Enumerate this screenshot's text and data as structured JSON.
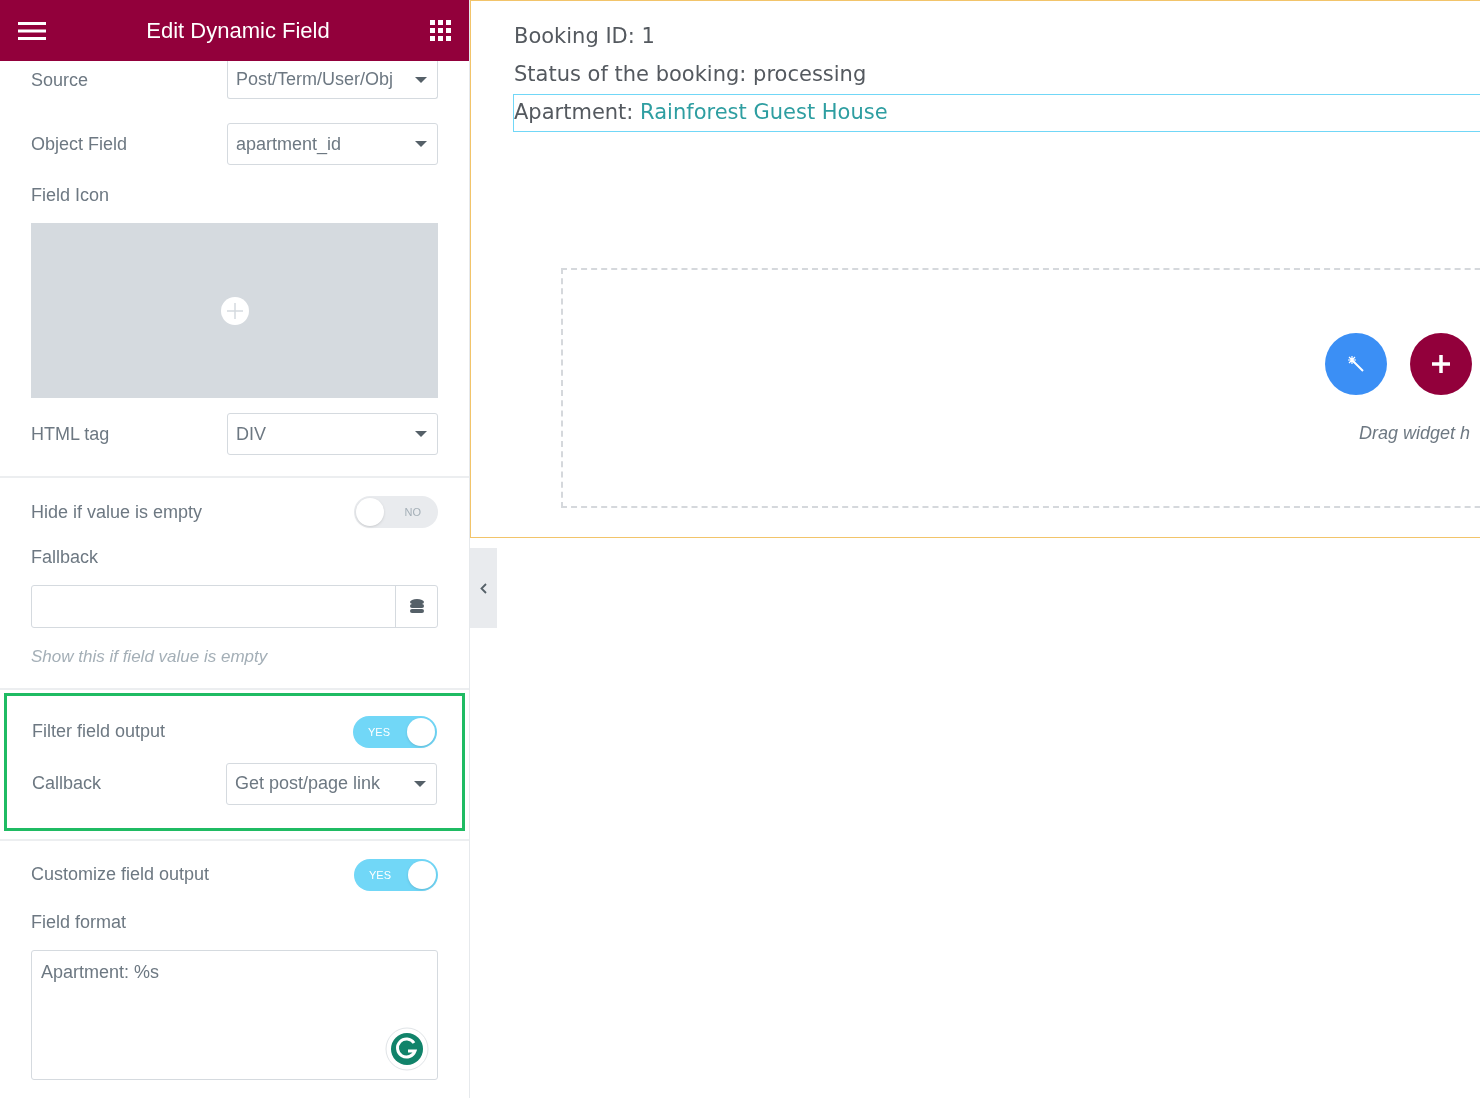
{
  "panel": {
    "title": "Edit Dynamic Field",
    "sections": [
      {
        "highlighted": false,
        "controls": [
          {
            "kind": "select",
            "label": "Source",
            "value": "Post/Term/User/Obj"
          },
          {
            "kind": "select",
            "label": "Object Field",
            "value": "apartment_id"
          },
          {
            "kind": "media",
            "label": "Field Icon"
          },
          {
            "kind": "select",
            "label": "HTML tag",
            "value": "DIV"
          }
        ]
      },
      {
        "highlighted": false,
        "controls": [
          {
            "kind": "toggle",
            "label": "Hide if value is empty",
            "on": false,
            "text": "NO"
          },
          {
            "kind": "input",
            "label": "Fallback"
          },
          {
            "kind": "note",
            "text": "Show this if field value is empty"
          }
        ]
      },
      {
        "highlighted": true,
        "controls": [
          {
            "kind": "toggle",
            "label": "Filter field output",
            "on": true,
            "text": "YES"
          },
          {
            "kind": "select",
            "label": "Callback",
            "value": "Get post/page link"
          }
        ]
      },
      {
        "highlighted": false,
        "controls": [
          {
            "kind": "toggle",
            "label": "Customize field output",
            "on": true,
            "text": "YES"
          },
          {
            "kind": "textarea",
            "label": "Field format",
            "value": "Apartment: %s"
          }
        ]
      }
    ]
  },
  "preview": {
    "lines": [
      {
        "text": "Booking ID: 1",
        "selected": false
      },
      {
        "text": "Status of the booking: processing",
        "selected": false
      },
      {
        "text": "Apartment: ",
        "link": "Rainforest Guest House",
        "selected": true
      }
    ],
    "drop_zone": {
      "caption": "Drag widget h"
    }
  }
}
